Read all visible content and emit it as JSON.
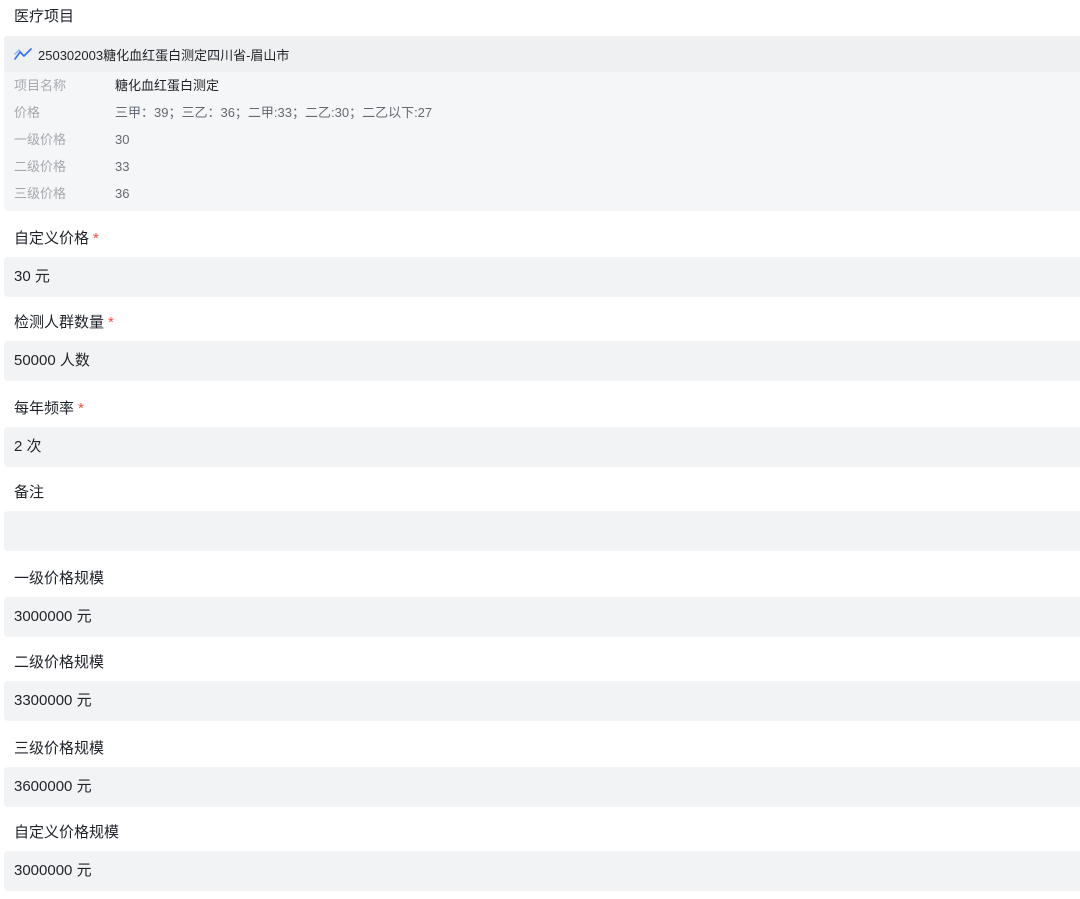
{
  "medical_project": {
    "label": "医疗项目",
    "item_title": "250302003糖化血红蛋白测定四川省-眉山市",
    "details": [
      {
        "key": "项目名称",
        "value": "糖化血红蛋白测定"
      },
      {
        "key": "价格",
        "value": "三甲：39；三乙：36；二甲:33；二乙:30；二乙以下:27"
      },
      {
        "key": "一级价格",
        "value": "30"
      },
      {
        "key": "二级价格",
        "value": "33"
      },
      {
        "key": "三级价格",
        "value": "36"
      }
    ]
  },
  "custom_price": {
    "label": "自定义价格",
    "required_mark": "*",
    "value": "30 元"
  },
  "population": {
    "label": "检测人群数量",
    "required_mark": "*",
    "value": "50000 人数"
  },
  "frequency": {
    "label": "每年频率",
    "required_mark": "*",
    "value": "2 次"
  },
  "remark": {
    "label": "备注",
    "value": ""
  },
  "scale_level1": {
    "label": "一级价格规模",
    "value": "3000000 元"
  },
  "scale_level2": {
    "label": "二级价格规模",
    "value": "3300000 元"
  },
  "scale_level3": {
    "label": "三级价格规模",
    "value": "3600000 元"
  },
  "scale_custom": {
    "label": "自定义价格规模",
    "value": "3000000 元"
  },
  "colors": {
    "required": "#f54a45",
    "icon": "#3370ff",
    "field_bg": "#f2f3f5"
  },
  "icons": {
    "project_icon": "trend-line-icon"
  }
}
